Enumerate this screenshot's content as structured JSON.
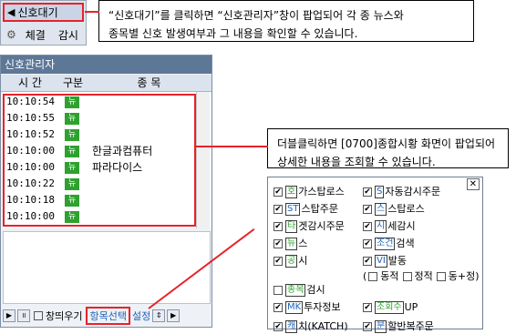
{
  "colors": {
    "accent_red": "#e5232b",
    "badge_green": "#2fa12f",
    "titlebar": "#5d7797",
    "option_label_blue": "#1e63b9",
    "option_label_green": "#2fa12f"
  },
  "mini_toolbar": {
    "signal_button_label": "신호대기",
    "execution_label": "체결",
    "monitor_label": "감시",
    "icon": "gear-icon"
  },
  "callout1": {
    "line1": "“신호대기”를 클릭하면 “신호관리자”창이 팝업되어 각 종 뉴스와",
    "line2": "종목별 신호 발생여부과 그 내용을 확인할 수 있습니다."
  },
  "callout2": {
    "line1": "더블클릭하면 [0700]종합시황 화면이 팝업되어",
    "line2": "상세한 내용을 조회할 수 있습니다."
  },
  "window": {
    "title": "신호관리자",
    "headers": {
      "time": "시  간",
      "type": "구분",
      "item": "종  목"
    },
    "rows": [
      {
        "time": "10:10:54",
        "type": "뉴",
        "name": ""
      },
      {
        "time": "10:10:55",
        "type": "뉴",
        "name": ""
      },
      {
        "time": "10:10:52",
        "type": "뉴",
        "name": ""
      },
      {
        "time": "10:10:00",
        "type": "뉴",
        "name": "한글과컴퓨터"
      },
      {
        "time": "10:10:00",
        "type": "뉴",
        "name": "파라다이스"
      },
      {
        "time": "10:10:22",
        "type": "뉴",
        "name": ""
      },
      {
        "time": "10:10:18",
        "type": "뉴",
        "name": ""
      },
      {
        "time": "10:10:00",
        "type": "뉴",
        "name": ""
      }
    ],
    "bottom": {
      "window_top_label": "창띄우기",
      "item_select_label": "항목선택",
      "settings_label": "설정"
    }
  },
  "options": {
    "close": "✕",
    "items": [
      {
        "label": "호",
        "rest": "가스탑로스",
        "checked": true
      },
      {
        "label": "S",
        "rest": "자동감시주문",
        "checked": true
      },
      {
        "label": "ST",
        "rest": "스탑주문",
        "checked": true
      },
      {
        "label": "스",
        "rest": "스탑로스",
        "checked": true
      },
      {
        "label": "타",
        "rest": "겟감시주문",
        "checked": true
      },
      {
        "label": "시",
        "rest": "세감시",
        "checked": true
      },
      {
        "label": "뉴",
        "rest": "스",
        "checked": true
      },
      {
        "label": "조건",
        "rest": "검색",
        "checked": true
      },
      {
        "label": "공",
        "rest": "시",
        "checked": true
      },
      {
        "label": "VI",
        "rest": "발동",
        "checked": true
      },
      {
        "label": "종목",
        "rest": "검시",
        "checked": false
      },
      {
        "label": "MK",
        "rest": "투자정보",
        "checked": true
      },
      {
        "label": "조회수",
        "rest": "UP",
        "checked": true
      },
      {
        "label": "캐",
        "rest": "치(KATCH)",
        "checked": true
      },
      {
        "label": "분",
        "rest": "할반복주문",
        "checked": true
      }
    ],
    "vi_sub": {
      "open": "(",
      "static": "동적",
      "dynamic": "정적",
      "both": "동+정",
      "close": ")"
    }
  }
}
